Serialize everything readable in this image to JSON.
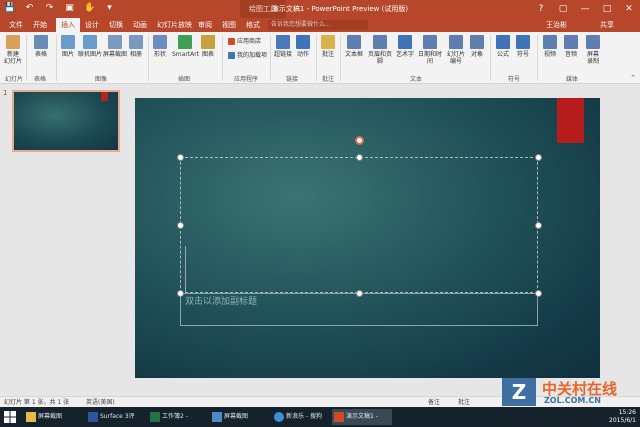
{
  "titlebar": {
    "drawing_tools": "绘图工具",
    "title": "演示文稿1 - PowerPoint Preview (试用版)",
    "qat_icons": [
      "save-icon",
      "undo-icon",
      "redo-icon",
      "present-icon",
      "touch-icon",
      "customize-icon"
    ],
    "controls": [
      "help",
      "minimize",
      "maximize",
      "close"
    ]
  },
  "tabs": [
    {
      "label": "文件"
    },
    {
      "label": "开始"
    },
    {
      "label": "插入",
      "active": true
    },
    {
      "label": "设计"
    },
    {
      "label": "切换"
    },
    {
      "label": "动画"
    },
    {
      "label": "幻灯片放映"
    },
    {
      "label": "审阅"
    },
    {
      "label": "视图"
    },
    {
      "label": "格式"
    }
  ],
  "tellme": "告诉我您想要做什么...",
  "user": "王治彬",
  "share": "共享",
  "ribbon": {
    "buttons": [
      {
        "label": "新建\n幻灯片",
        "color": "#d8a05a"
      },
      {
        "label": "表格",
        "color": "#6b8bb7"
      },
      {
        "label": "图片",
        "color": "#6b9bc8"
      },
      {
        "label": "联机图片",
        "color": "#6b9bc8"
      },
      {
        "label": "屏幕截图",
        "color": "#7a9ac0"
      },
      {
        "label": "相册",
        "color": "#7a9ac0"
      },
      {
        "label": "形状",
        "color": "#6a8fbf"
      },
      {
        "label": "SmartArt",
        "color": "#3f9e58"
      },
      {
        "label": "图表",
        "color": "#c8a040"
      },
      {
        "label": "应用商店",
        "color": "#d24a2a"
      },
      {
        "label": "我的加载项",
        "color": "#3f74b8"
      },
      {
        "label": "超链接",
        "color": "#4a78b8"
      },
      {
        "label": "动作",
        "color": "#3f74b8"
      },
      {
        "label": "批注",
        "color": "#d9b44a"
      },
      {
        "label": "文本框",
        "color": "#5f7fb0"
      },
      {
        "label": "页眉和页脚",
        "color": "#5f7fb0"
      },
      {
        "label": "艺术字",
        "color": "#3f74b8"
      },
      {
        "label": "日期和时间",
        "color": "#5f7fb0"
      },
      {
        "label": "幻灯片\n编号",
        "color": "#5f7fb0"
      },
      {
        "label": "对象",
        "color": "#5f7fb0"
      },
      {
        "label": "公式",
        "color": "#3f74b8"
      },
      {
        "label": "符号",
        "color": "#3f74b8"
      },
      {
        "label": "视频",
        "color": "#5f7fb0"
      },
      {
        "label": "音频",
        "color": "#5f7fb0"
      },
      {
        "label": "屏幕\n录制",
        "color": "#5f7fb0"
      }
    ],
    "groups": [
      "幻灯片",
      "表格",
      "图像",
      "插图",
      "应用程序",
      "链接",
      "批注",
      "文本",
      "符号",
      "媒体"
    ]
  },
  "thumbnail": {
    "number": "1"
  },
  "slide": {
    "subtitle_placeholder": "双击以添加副标题",
    "accent_color": "#b61c1c"
  },
  "status": {
    "slide_count": "幻灯片 第 1 张，共 1 张",
    "language": "英语(美国)",
    "notes": "备注",
    "comments": "批注"
  },
  "taskbar": {
    "items": [
      {
        "label": "屏幕截图"
      },
      {
        "label": "Surface 3评测..."
      },
      {
        "label": "工作簿2 - Exce..."
      },
      {
        "label": "屏幕截图(22).p..."
      },
      {
        "label": "新浪乐 - 搜狗拍..."
      },
      {
        "label": "演示文稿1 - Po...",
        "active": true
      }
    ],
    "time": "15:26",
    "date": "2015/6/1"
  },
  "watermark": {
    "brand": "中关村在线",
    "domain": "ZOL.COM.CN",
    "logo_letter": "Z"
  }
}
